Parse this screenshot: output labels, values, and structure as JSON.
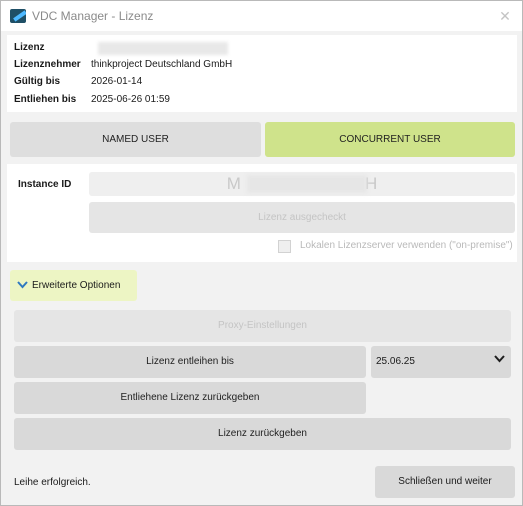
{
  "window": {
    "title": "VDC Manager - Lizenz",
    "close_glyph": "✕"
  },
  "info": {
    "rows": [
      {
        "label": "Lizenz",
        "value": ""
      },
      {
        "label": "Lizenznehmer",
        "value": "thinkproject Deutschland GmbH"
      },
      {
        "label": "Gültig bis",
        "value": "2026-01-14"
      },
      {
        "label": "Entliehen bis",
        "value": "2025-06-26 01:59"
      }
    ]
  },
  "license_modes": {
    "named": "NAMED USER",
    "concurrent": "CONCURRENT USER",
    "selected": "concurrent",
    "selected_color": "#cfe38b"
  },
  "instance": {
    "label": "Instance ID",
    "value_prefix": "M",
    "value_suffix": "H",
    "checked_out_button": "Lizenz ausgecheckt",
    "onprem_checkbox_label": "Lokalen Lizenzserver verwenden (\"on-premise\")",
    "onprem_checked": false
  },
  "advanced": {
    "toggle_label": "Erweiterte Optionen",
    "toggle_color": "#edf5c4",
    "chevron_icon": "chevron-down-icon",
    "proxy_button": "Proxy-Einstellungen",
    "borrow_button": "Lizenz entleihen bis",
    "borrow_date": "25.06.25",
    "return_borrowed_button": "Entliehene Lizenz zurückgeben",
    "return_license_button": "Lizenz zurückgeben"
  },
  "footer": {
    "status": "Leihe erfolgreich.",
    "close_continue_button": "Schließen und weiter"
  }
}
